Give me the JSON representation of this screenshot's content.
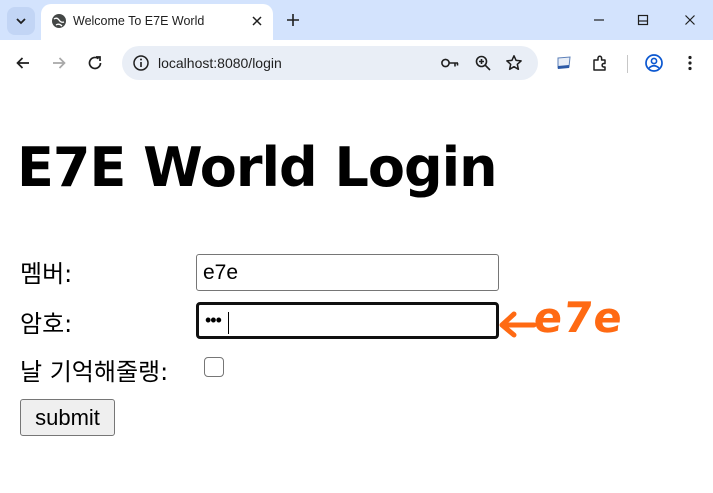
{
  "browser": {
    "tab_title": "Welcome To E7E World",
    "url_host": "localhost",
    "url_rest": ":8080/login",
    "accent_color": "#d3e3fd"
  },
  "icons": {
    "tab_search": "chevron-down-icon",
    "favicon": "globe-icon",
    "close": "close-icon",
    "new_tab": "plus-icon",
    "minimize": "minimize-icon",
    "maximize": "maximize-icon",
    "window_close": "window-close-icon",
    "back": "back-arrow-icon",
    "forward": "forward-arrow-icon",
    "reload": "reload-icon",
    "site_info": "info-icon",
    "password": "key-icon",
    "zoom": "zoom-icon",
    "bookmark": "star-icon",
    "extension_app": "note-icon",
    "extensions": "puzzle-icon",
    "profile": "profile-icon",
    "menu": "kebab-menu-icon"
  },
  "page": {
    "title": "E7E World Login",
    "member_label": "멤버:",
    "member_value": "e7e",
    "password_label": "암호:",
    "password_mask": "•••",
    "remember_label": "날 기억해줄랭:",
    "remember_checked": false,
    "submit_label": "submit"
  },
  "annotation": {
    "text": "e7e",
    "color": "#ff6a13"
  }
}
